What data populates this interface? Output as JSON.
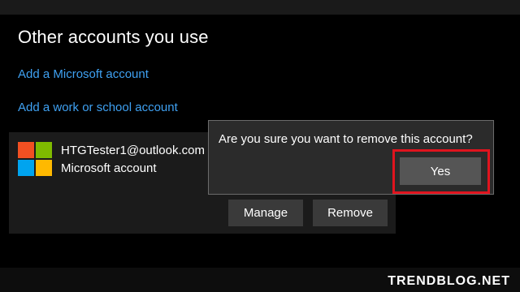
{
  "section": {
    "heading": "Other accounts you use",
    "add_microsoft_link": "Add a Microsoft account",
    "add_work_link": "Add a work or school account"
  },
  "account": {
    "email": "HTGTester1@outlook.com",
    "type": "Microsoft account",
    "icon": "microsoft-logo",
    "manage_label": "Manage",
    "remove_label": "Remove"
  },
  "confirm_dialog": {
    "message": "Are you sure you want to remove this account?",
    "yes_label": "Yes"
  },
  "watermark": "TRENDBLOG.NET",
  "colors": {
    "background": "#000000",
    "link": "#3fa1f2",
    "highlight": "#e0141e",
    "ms_red": "#f25022",
    "ms_green": "#7fba00",
    "ms_blue": "#00a4ef",
    "ms_yellow": "#ffb900"
  }
}
